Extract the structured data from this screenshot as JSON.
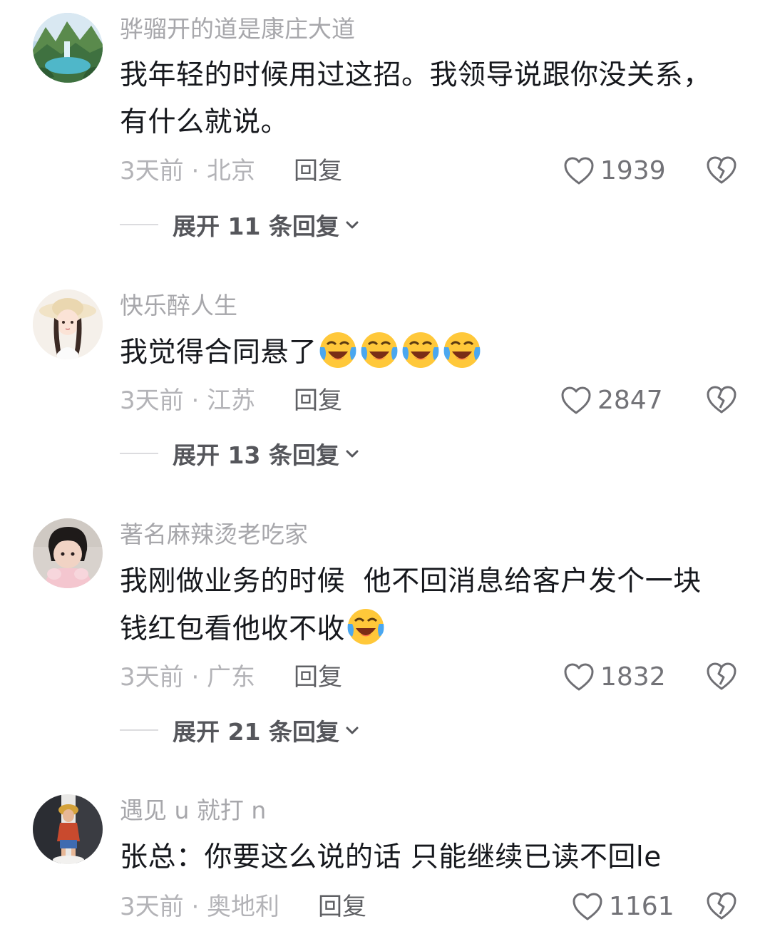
{
  "comments": [
    {
      "username": "骅骝开的道是康庄大道",
      "text_lines": [
        "我年轻的时候用过这招。我领导说跟你没关系，",
        "有什么就说。"
      ],
      "meta": "3天前 · 北京",
      "reply_label": "回复",
      "likes": "1939",
      "expand_label": "展开 11 条回复",
      "avatar_icon": "landscape-avatar-icon"
    },
    {
      "username": "快乐醉人生",
      "text_lines": [
        "我觉得合同悬了"
      ],
      "emoji_count": 4,
      "meta": "3天前 · 江苏",
      "reply_label": "回复",
      "likes": "2847",
      "expand_label": "展开 13 条回复",
      "avatar_icon": "girl-with-hat-avatar-icon"
    },
    {
      "username": "著名麻辣烫老吃家",
      "text_lines": [
        "我刚做业务的时候  他不回消息给客户发个一块",
        "钱红包看他收不收"
      ],
      "emoji_count": 1,
      "meta": "3天前 · 广东",
      "reply_label": "回复",
      "likes": "1832",
      "expand_label": "展开 21 条回复",
      "avatar_icon": "child-photo-avatar-icon"
    },
    {
      "username": "遇见 u 就打 n",
      "text_lines": [
        "张总：你要这么说的话 只能继续已读不回le"
      ],
      "meta": "3天前 · 奥地利",
      "reply_label": "回复",
      "likes": "1161",
      "avatar_icon": "figure-avatar-icon"
    }
  ],
  "icons": {
    "like": "heart-outline-icon",
    "dislike": "broken-heart-icon",
    "expand": "chevron-down-icon",
    "emoji": "laughing-tears-emoji-icon"
  },
  "colors": {
    "username": "#a7a7ab",
    "text": "#16181d",
    "meta": "#b3b3b7",
    "reply": "#5f6064",
    "expand": "#55565b"
  }
}
